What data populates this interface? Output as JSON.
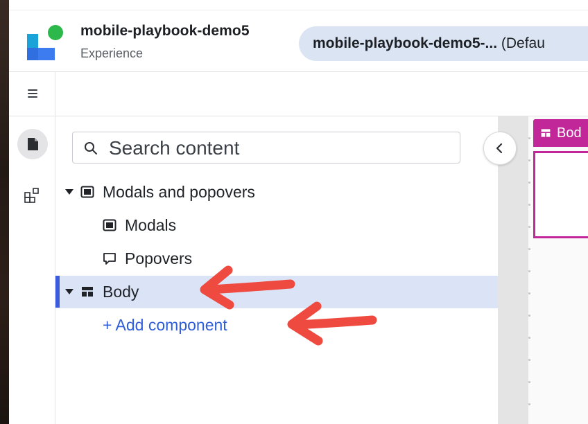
{
  "app": {
    "title": "mobile-playbook-demo5",
    "subtitle": "Experience"
  },
  "environment": {
    "name_bold": "mobile-playbook-demo5-...",
    "suffix": " (Defau"
  },
  "search": {
    "placeholder": "Search content"
  },
  "tree": {
    "modals_popovers": "Modals and popovers",
    "modals": "Modals",
    "popovers": "Popovers",
    "body": "Body",
    "add_component": "+ Add component"
  },
  "canvas": {
    "body_tag": "Bod"
  },
  "icons": {
    "menu": "hamburger-icon",
    "pages": "page-icon",
    "components": "components-icon",
    "search": "search-icon",
    "collapse": "chevron-left-icon"
  },
  "colors": {
    "accent_blue": "#3b5bdb",
    "selected_row": "#dbe4f6",
    "link_blue": "#2f5fd8",
    "magenta": "#c2279a",
    "annotation_red": "#ee4a3f",
    "env_pill": "#dbe4f3"
  }
}
